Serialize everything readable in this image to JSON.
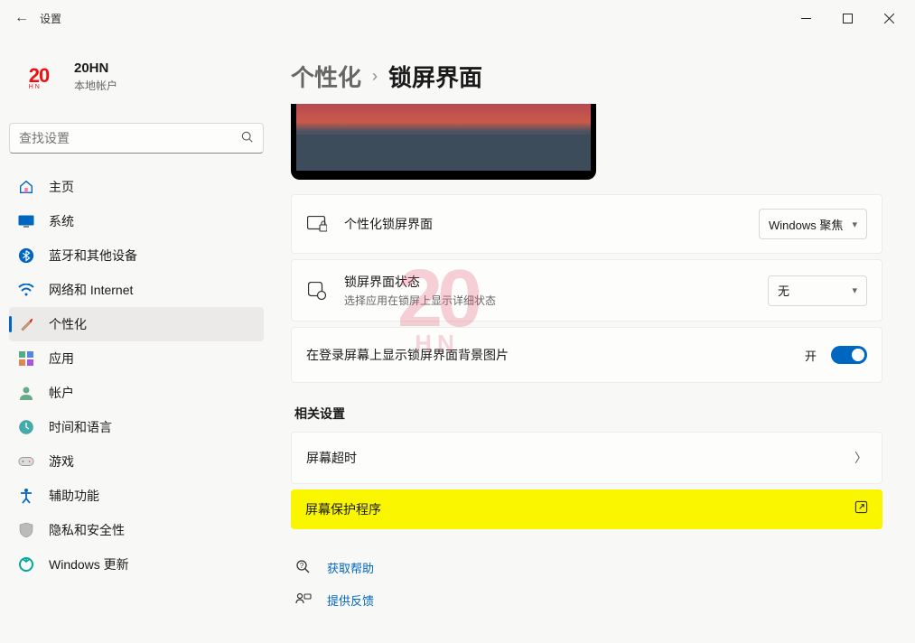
{
  "window": {
    "title": "设置"
  },
  "user": {
    "name": "20HN",
    "type": "本地帐户",
    "logo_text": "20",
    "logo_sub": "HN"
  },
  "search": {
    "placeholder": "查找设置"
  },
  "nav": [
    {
      "label": "主页"
    },
    {
      "label": "系统"
    },
    {
      "label": "蓝牙和其他设备"
    },
    {
      "label": "网络和 Internet"
    },
    {
      "label": "个性化"
    },
    {
      "label": "应用"
    },
    {
      "label": "帐户"
    },
    {
      "label": "时间和语言"
    },
    {
      "label": "游戏"
    },
    {
      "label": "辅助功能"
    },
    {
      "label": "隐私和安全性"
    },
    {
      "label": "Windows 更新"
    }
  ],
  "breadcrumb": {
    "parent": "个性化",
    "current": "锁屏界面"
  },
  "settings": {
    "personalize": {
      "title": "个性化锁屏界面",
      "value": "Windows 聚焦"
    },
    "status": {
      "title": "锁屏界面状态",
      "sub": "选择应用在锁屏上显示详细状态",
      "value": "无"
    },
    "signin_bg": {
      "title": "在登录屏幕上显示锁屏界面背景图片",
      "toggle_label": "开"
    }
  },
  "related": {
    "heading": "相关设置",
    "timeout": {
      "title": "屏幕超时"
    },
    "screensaver": {
      "title": "屏幕保护程序"
    }
  },
  "help": {
    "get_help": "获取帮助",
    "feedback": "提供反馈"
  },
  "watermark": {
    "main": "20",
    "sub": "HN"
  }
}
